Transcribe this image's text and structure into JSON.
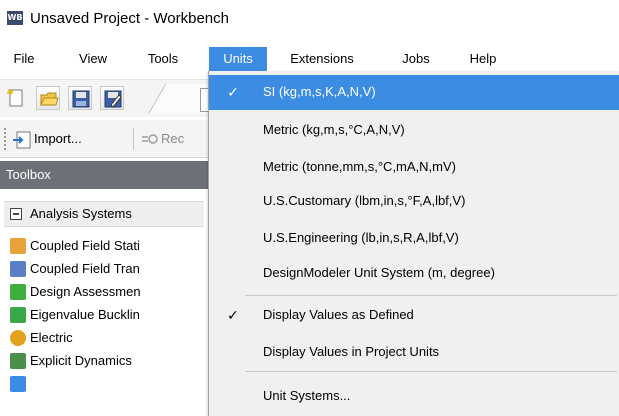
{
  "window": {
    "app_icon": "WB",
    "title": "Unsaved Project - Workbench"
  },
  "menubar": {
    "items": [
      "File",
      "View",
      "Tools",
      "Units",
      "Extensions",
      "Jobs",
      "Help"
    ],
    "active": "Units"
  },
  "toolbar": {
    "import_label": "Import...",
    "reconnect_label": "Rec"
  },
  "toolbox": {
    "title": "Toolbox",
    "group_label": "Analysis Systems",
    "items": [
      {
        "label": "Coupled Field Stati",
        "icon": "coupled-field-static-icon",
        "color": "#e8a23a"
      },
      {
        "label": "Coupled Field Tran",
        "icon": "coupled-field-transient-icon",
        "color": "#5a7fc4"
      },
      {
        "label": "Design Assessmen",
        "icon": "design-assessment-icon",
        "color": "#3fae3f"
      },
      {
        "label": "Eigenvalue Bucklin",
        "icon": "eigenvalue-buckling-icon",
        "color": "#3aa848"
      },
      {
        "label": "Electric",
        "icon": "electric-icon",
        "color": "#e2a21b"
      },
      {
        "label": "Explicit Dynamics",
        "icon": "explicit-dynamics-icon",
        "color": "#4a8f4a"
      }
    ]
  },
  "units_menu": {
    "items": [
      {
        "label": "SI (kg,m,s,K,A,N,V)",
        "checked": true,
        "highlight": true
      },
      {
        "label": "Metric (kg,m,s,°C,A,N,V)",
        "checked": false
      },
      {
        "label": "Metric (tonne,mm,s,°C,mA,N,mV)",
        "checked": false
      },
      {
        "label": "U.S.Customary (lbm,in,s,°F,A,lbf,V)",
        "checked": false
      },
      {
        "label": "U.S.Engineering (lb,in,s,R,A,lbf,V)",
        "checked": false
      },
      {
        "label": "DesignModeler Unit System (m, degree)",
        "checked": false
      },
      {
        "label": "Display Values as Defined",
        "checked": true
      },
      {
        "label": "Display Values in Project Units",
        "checked": false
      },
      {
        "label": "Unit Systems...",
        "checked": false
      }
    ],
    "check_glyph": "✓"
  },
  "colors": {
    "accent": "#3c8ce3",
    "toolbox_header": "#6d7076",
    "menu_bg": "#f0f0f0"
  }
}
